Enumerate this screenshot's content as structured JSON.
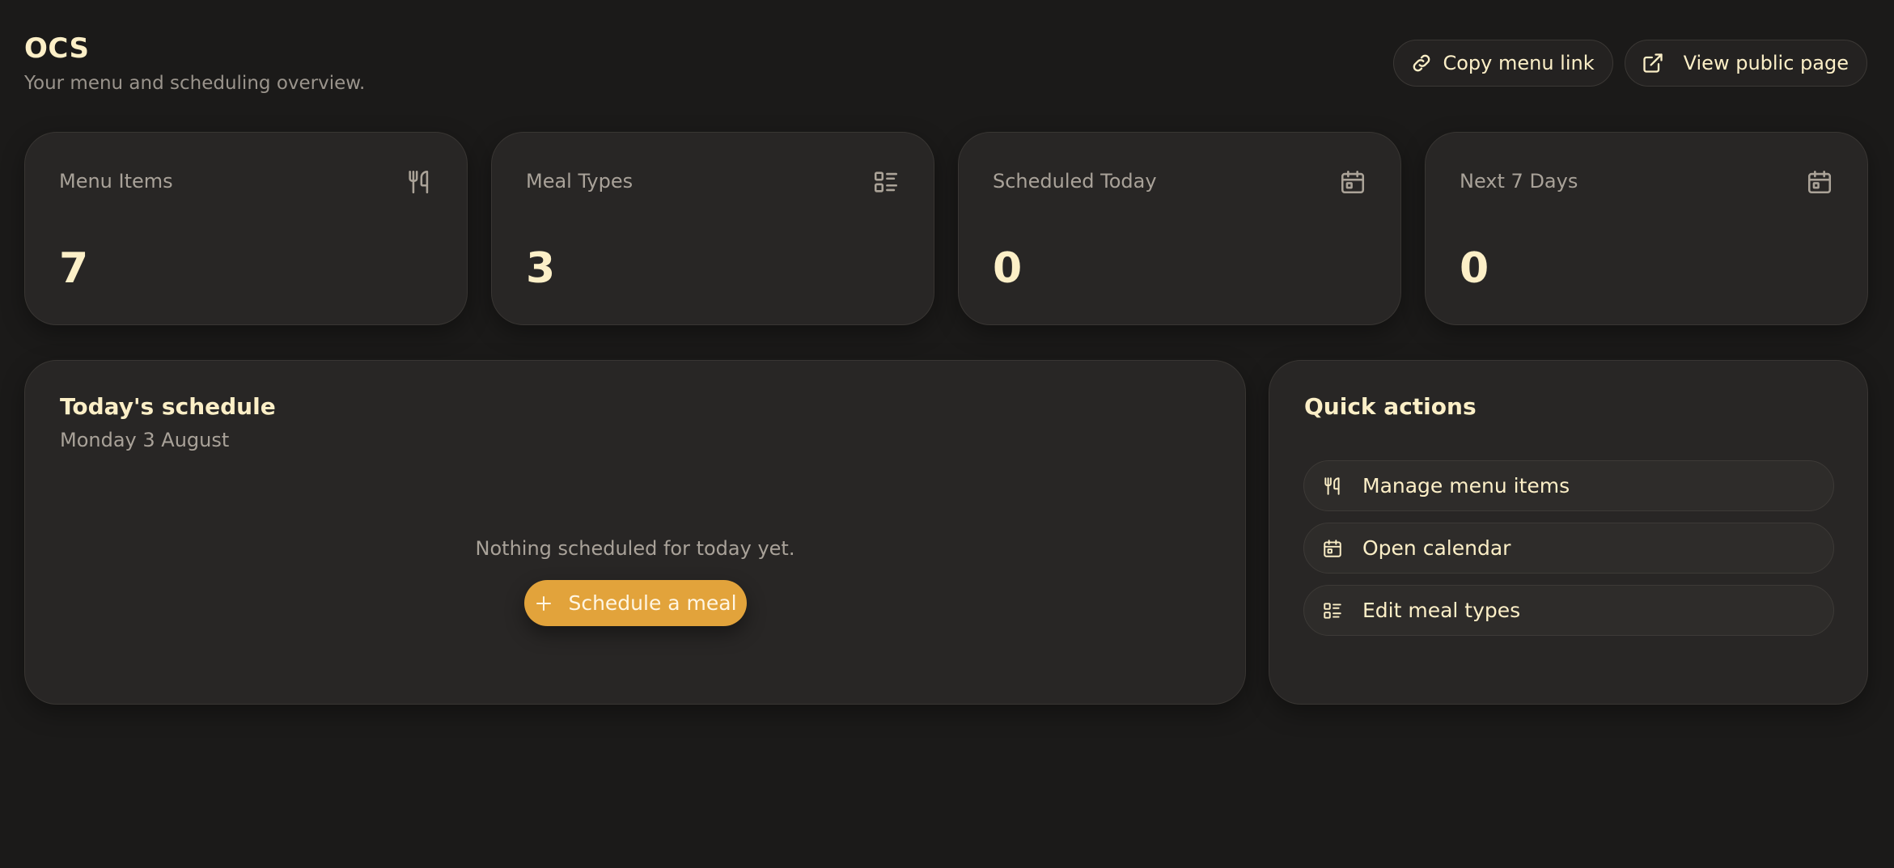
{
  "header": {
    "title": "OCS",
    "subtitle": "Your menu and scheduling overview.",
    "copy_link_label": "Copy menu link",
    "view_public_label": "View public page"
  },
  "stats": [
    {
      "label": "Menu Items",
      "value": "7",
      "icon": "utensils-icon"
    },
    {
      "label": "Meal Types",
      "value": "3",
      "icon": "list-icon"
    },
    {
      "label": "Scheduled Today",
      "value": "0",
      "icon": "calendar-icon"
    },
    {
      "label": "Next 7 Days",
      "value": "0",
      "icon": "calendar-icon"
    }
  ],
  "schedule": {
    "title": "Today's schedule",
    "date": "Monday 3 August",
    "empty_text": "Nothing scheduled for today yet.",
    "button_label": "Schedule a meal"
  },
  "quick_actions": {
    "title": "Quick actions",
    "items": [
      {
        "label": "Manage menu items",
        "icon": "utensils-icon"
      },
      {
        "label": "Open calendar",
        "icon": "calendar-icon"
      },
      {
        "label": "Edit meal types",
        "icon": "list-icon"
      }
    ]
  },
  "colors": {
    "background": "#1b1a19",
    "card": "#282625",
    "accent": "#e2a33b",
    "text_primary": "#fcefc7",
    "text_muted": "#a9a299"
  }
}
